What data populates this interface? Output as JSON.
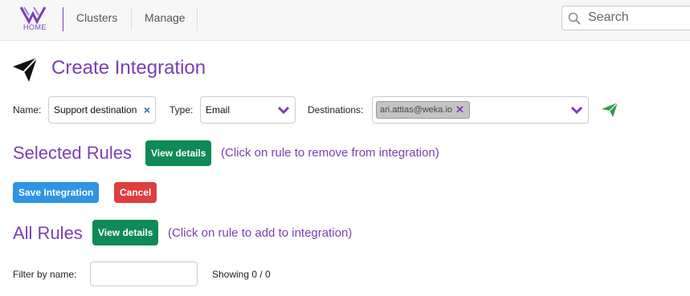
{
  "header": {
    "logo_text": "HOME",
    "nav": [
      {
        "label": "Clusters"
      },
      {
        "label": "Manage"
      }
    ],
    "search_placeholder": "Search"
  },
  "page": {
    "title": "Create Integration"
  },
  "form": {
    "name_label": "Name:",
    "name_value": "Support destination",
    "type_label": "Type:",
    "type_value": "Email",
    "destinations_label": "Destinations:",
    "destination_tags": [
      "ari.attias@weka.io"
    ]
  },
  "selected_rules": {
    "title": "Selected Rules",
    "view_details_label": "View details",
    "hint": "(Click on rule to remove from integration)"
  },
  "actions": {
    "save_label": "Save Integration",
    "cancel_label": "Cancel"
  },
  "all_rules": {
    "title": "All Rules",
    "view_details_label": "View details",
    "hint": "(Click on rule to add to integration)",
    "filter_label": "Filter by name:",
    "filter_value": "",
    "showing": "Showing 0 / 0"
  },
  "colors": {
    "accent": "#7b3fb3",
    "success": "#0e8a55",
    "primary": "#2e94e3",
    "danger": "#e03e3e",
    "send_icon": "#2e9b4a"
  }
}
